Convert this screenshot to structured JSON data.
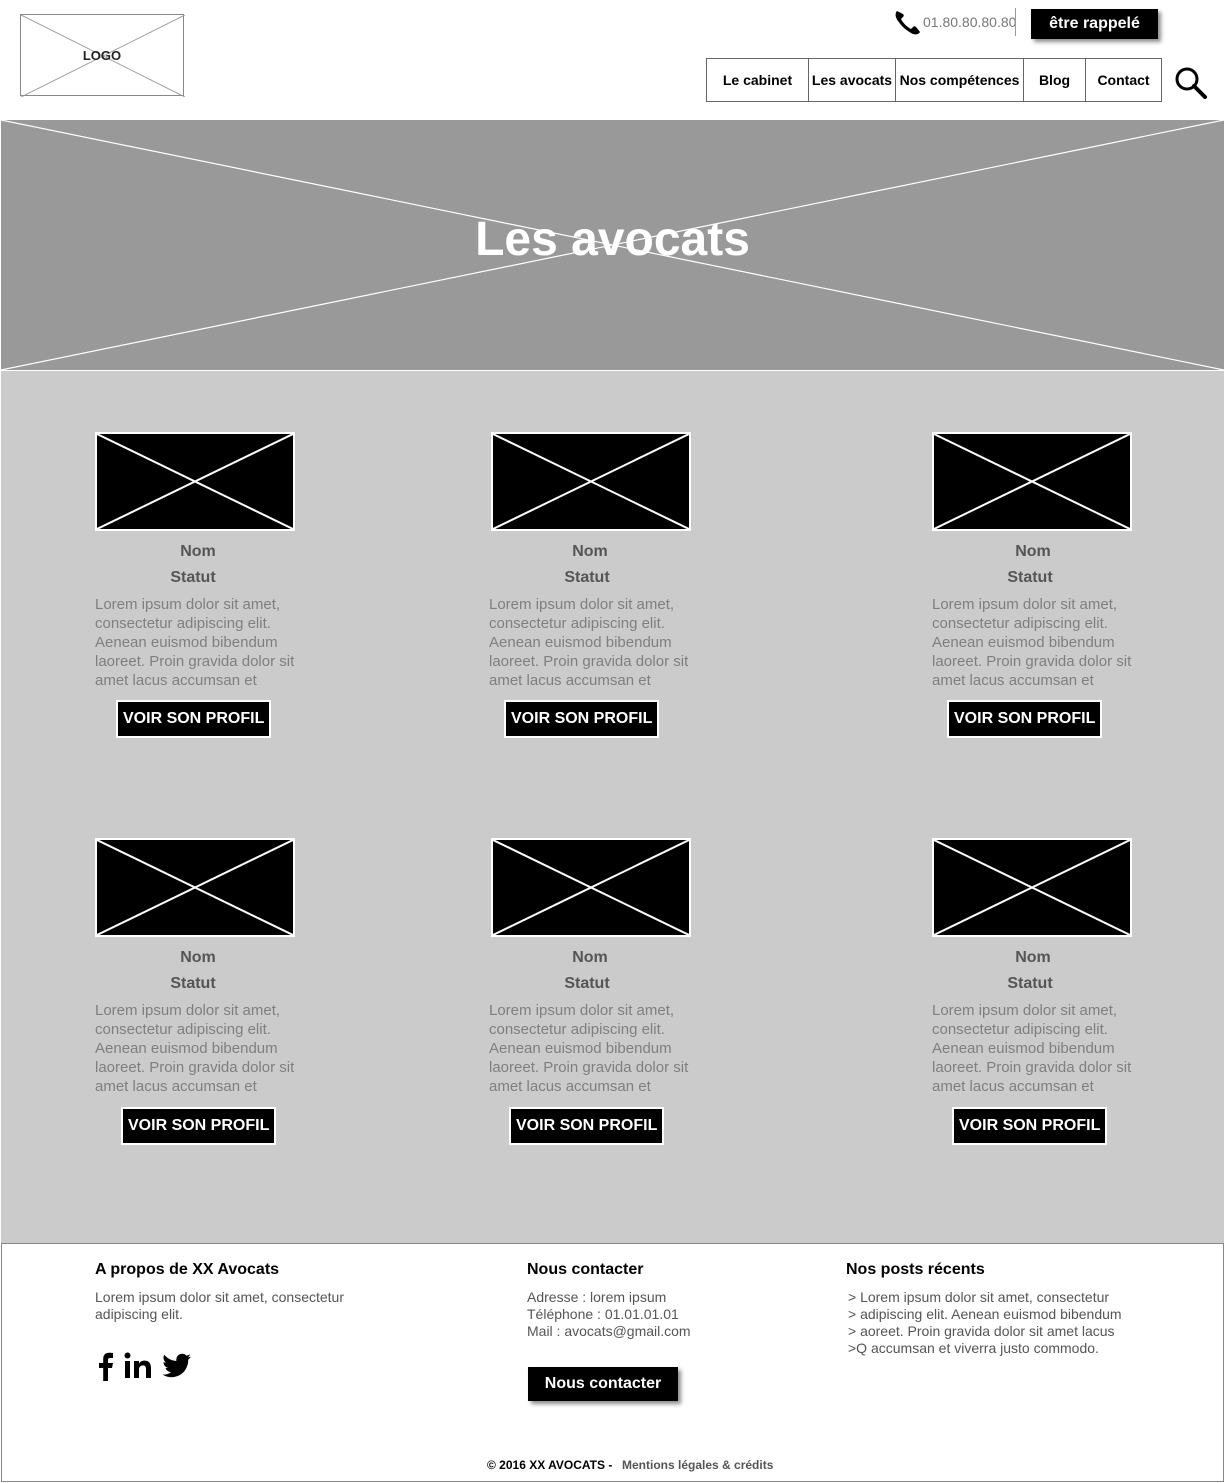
{
  "header": {
    "logo_text": "LOGO",
    "phone_number": "01.80.80.80.80",
    "callback_label": "être rappelé",
    "nav": [
      {
        "label": "Le cabinet"
      },
      {
        "label": "Les avocats"
      },
      {
        "label": "Nos compétences"
      },
      {
        "label": "Blog"
      },
      {
        "label": "Contact"
      }
    ]
  },
  "hero": {
    "title": "Les avocats"
  },
  "lawyers": [
    {
      "name": "Nom",
      "status": "Statut",
      "bio": "Lorem ipsum dolor sit amet, consectetur adipiscing elit. Aenean euismod bibendum laoreet. Proin gravida dolor sit amet lacus accumsan et",
      "button": "VOIR SON PROFIL"
    },
    {
      "name": "Nom",
      "status": "Statut",
      "bio": "Lorem ipsum dolor sit amet, consectetur adipiscing elit. Aenean euismod bibendum laoreet. Proin gravida dolor sit amet lacus accumsan et",
      "button": "VOIR SON PROFIL"
    },
    {
      "name": "Nom",
      "status": "Statut",
      "bio": "Lorem ipsum dolor sit amet, consectetur adipiscing elit. Aenean euismod bibendum laoreet. Proin gravida dolor sit amet lacus accumsan et",
      "button": "VOIR SON PROFIL"
    },
    {
      "name": "Nom",
      "status": "Statut",
      "bio": "Lorem ipsum dolor sit amet, consectetur adipiscing elit. Aenean euismod bibendum laoreet. Proin gravida dolor sit amet lacus accumsan et",
      "button": "VOIR SON PROFIL"
    },
    {
      "name": "Nom",
      "status": "Statut",
      "bio": "Lorem ipsum dolor sit amet, consectetur adipiscing elit. Aenean euismod bibendum laoreet. Proin gravida dolor sit amet lacus accumsan et",
      "button": "VOIR SON PROFIL"
    },
    {
      "name": "Nom",
      "status": "Statut",
      "bio": "Lorem ipsum dolor sit amet, consectetur adipiscing elit. Aenean euismod bibendum laoreet. Proin gravida dolor sit amet lacus accumsan et",
      "button": "VOIR SON PROFIL"
    }
  ],
  "footer": {
    "about": {
      "title": "A propos de XX Avocats",
      "text_line1": "Lorem ipsum dolor sit amet, consectetur",
      "text_line2": "adipiscing elit."
    },
    "social_icons": [
      "facebook-icon",
      "linkedin-icon",
      "twitter-icon"
    ],
    "contact": {
      "title": "Nous contacter",
      "address": "Adresse : lorem ipsum",
      "phone": "Téléphone : 01.01.01.01",
      "mail": "Mail : avocats@gmail.com",
      "button": "Nous contacter"
    },
    "posts": {
      "title": "Nos posts récents",
      "items": [
        "> Lorem ipsum dolor sit amet, consectetur",
        "> adipiscing elit. Aenean euismod bibendum",
        "> aoreet. Proin gravida dolor sit amet lacus",
        ">Q accumsan et viverra justo commodo."
      ]
    },
    "copyright": "© 2016 XX AVOCATS -",
    "legal_link": "Mentions légales & crédits"
  }
}
